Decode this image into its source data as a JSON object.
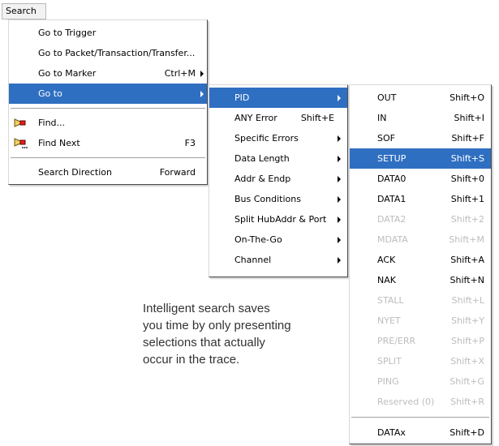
{
  "menubar": {
    "search": "Search"
  },
  "search_menu": {
    "items": [
      {
        "label": "Go to Trigger",
        "shortcut": ""
      },
      {
        "label": "Go to Packet/Transaction/Transfer...",
        "shortcut": ""
      },
      {
        "label": "Go to Marker",
        "shortcut": "Ctrl+M"
      },
      {
        "label": "Go to",
        "shortcut": ""
      },
      {
        "label": "Find...",
        "shortcut": ""
      },
      {
        "label": "Find Next",
        "shortcut": "F3"
      },
      {
        "label": "Search Direction",
        "shortcut": "Forward"
      }
    ]
  },
  "goto_menu": {
    "items": [
      {
        "label": "PID",
        "shortcut": ""
      },
      {
        "label": "ANY Error",
        "shortcut": "Shift+E"
      },
      {
        "label": "Specific Errors",
        "shortcut": ""
      },
      {
        "label": "Data Length",
        "shortcut": ""
      },
      {
        "label": "Addr & Endp",
        "shortcut": ""
      },
      {
        "label": "Bus Conditions",
        "shortcut": ""
      },
      {
        "label": "Split HubAddr & Port",
        "shortcut": ""
      },
      {
        "label": "On-The-Go",
        "shortcut": ""
      },
      {
        "label": "Channel",
        "shortcut": ""
      }
    ]
  },
  "pid_menu": {
    "items": [
      {
        "label": "OUT",
        "shortcut": "Shift+O"
      },
      {
        "label": "IN",
        "shortcut": "Shift+I"
      },
      {
        "label": "SOF",
        "shortcut": "Shift+F"
      },
      {
        "label": "SETUP",
        "shortcut": "Shift+S"
      },
      {
        "label": "DATA0",
        "shortcut": "Shift+0"
      },
      {
        "label": "DATA1",
        "shortcut": "Shift+1"
      },
      {
        "label": "DATA2",
        "shortcut": "Shift+2"
      },
      {
        "label": "MDATA",
        "shortcut": "Shift+M"
      },
      {
        "label": "ACK",
        "shortcut": "Shift+A"
      },
      {
        "label": "NAK",
        "shortcut": "Shift+N"
      },
      {
        "label": "STALL",
        "shortcut": "Shift+L"
      },
      {
        "label": "NYET",
        "shortcut": "Shift+Y"
      },
      {
        "label": "PRE/ERR",
        "shortcut": "Shift+P"
      },
      {
        "label": "SPLIT",
        "shortcut": "Shift+X"
      },
      {
        "label": "PING",
        "shortcut": "Shift+G"
      },
      {
        "label": "Reserved (0)",
        "shortcut": "Shift+R"
      },
      {
        "label": "DATAx",
        "shortcut": "Shift+D"
      }
    ]
  },
  "note": {
    "line1": "Intelligent search saves",
    "line2": "you time by only presenting",
    "line3": "selections that actually",
    "line4": "occur in the trace."
  },
  "colors": {
    "selection": "#2f6fc2",
    "disabled_text": "#bdbdbd"
  },
  "icons": {
    "find": "flashlight-icon",
    "find_next": "flashlight-next-icon",
    "submenu": "submenu-arrow-icon"
  }
}
